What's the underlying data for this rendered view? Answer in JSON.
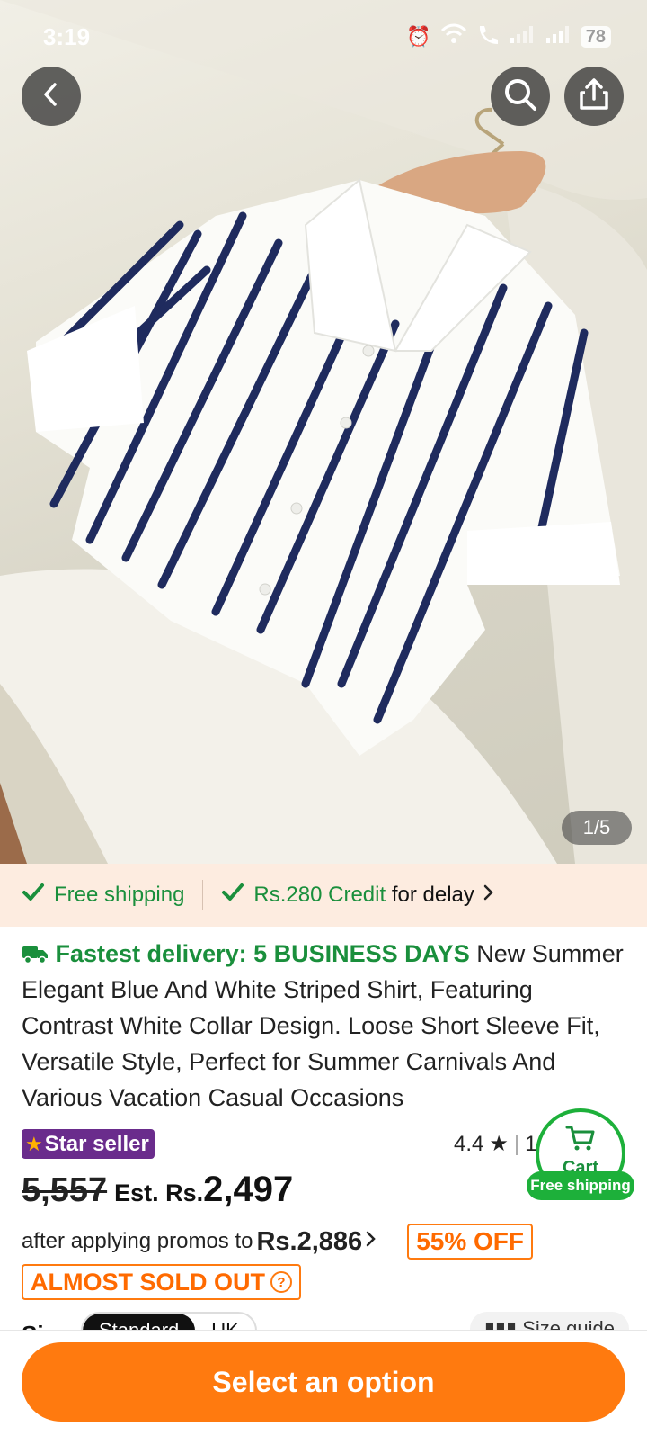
{
  "status_bar": {
    "time": "3:19",
    "battery": "78"
  },
  "header": {
    "back_icon": "chevron-left-icon",
    "search_icon": "search-icon",
    "share_icon": "share-icon"
  },
  "gallery": {
    "counter": "1/5"
  },
  "shipping_strip": {
    "free_shipping": "Free shipping",
    "credit_amount": "Rs.280 Credit",
    "credit_suffix": "for delay"
  },
  "product": {
    "fastest_delivery": "Fastest delivery: 5 BUSINESS DAYS",
    "title": "New Summer Elegant Blue And White Striped Shirt, Featuring Contrast White Collar Design. Loose Short Sleeve Fit, Versatile Style, Perfect for Summer Carnivals And Various Vacation Casual Occasions",
    "star_seller": "Star seller",
    "rating": "4.4",
    "rating_count_partial": "1"
  },
  "cart_float": {
    "label": "Cart",
    "free_shipping": "Free shipping"
  },
  "pricing": {
    "original": "5,557",
    "est_prefix": "Est. Rs.",
    "current": "2,497",
    "promo_text": "after applying promos to",
    "promo_price": "Rs.2,886",
    "discount": "55% OFF",
    "stock_status": "ALMOST SOLD OUT"
  },
  "size": {
    "label": "Size",
    "options": [
      "Standard",
      "UK"
    ],
    "guide": "Size guide"
  },
  "bottom": {
    "select_option": "Select an option"
  },
  "colors": {
    "accent_orange": "#ff7a0f",
    "success_green": "#1a8f3c",
    "star_purple": "#6a2c8c",
    "strip_bg": "#fdece0"
  }
}
